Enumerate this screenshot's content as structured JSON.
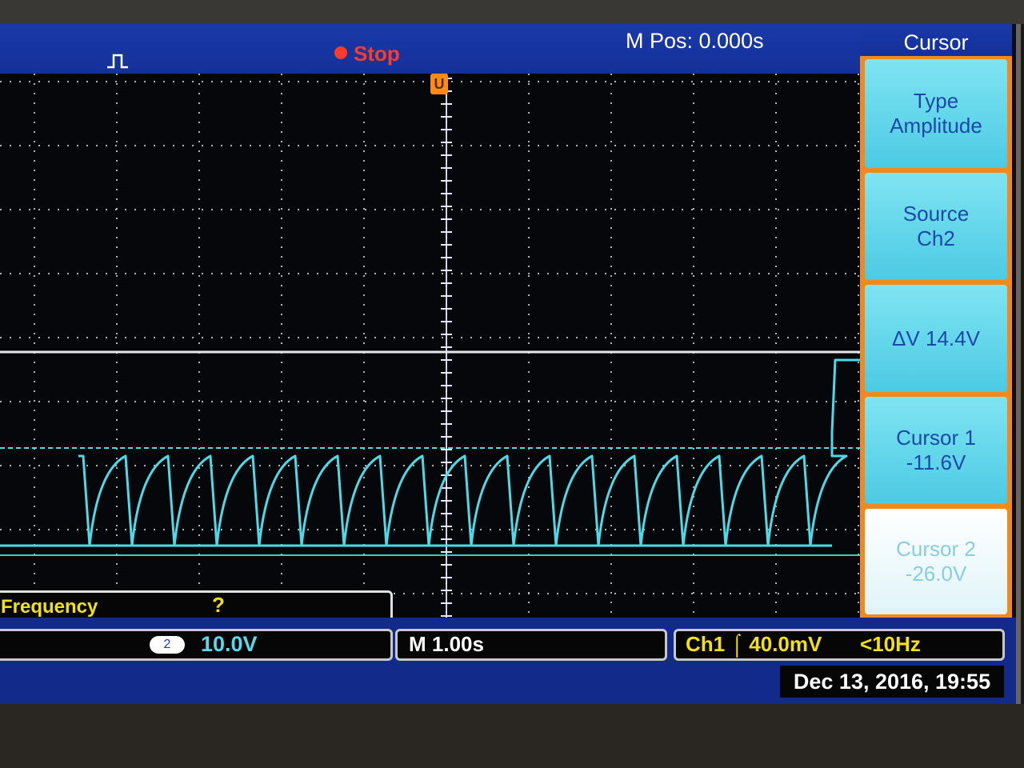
{
  "header": {
    "run_state": "Stop",
    "m_pos": "M Pos: 0.000s",
    "trigger_marker": "U"
  },
  "cursor_menu": {
    "title": "Cursor",
    "buttons": [
      {
        "line1": "Type",
        "line2": "Amplitude"
      },
      {
        "line1": "Source",
        "line2": "Ch2"
      },
      {
        "line1": "ΔV 14.4V",
        "line2": ""
      },
      {
        "line1": "Cursor 1",
        "line2": "-11.6V"
      },
      {
        "line1": "Cursor 2",
        "line2": "-26.0V"
      }
    ]
  },
  "measurement": {
    "label": "Frequency",
    "value": "?"
  },
  "status": {
    "ch2_badge": "2",
    "ch2_scale": "10.0V",
    "timebase": "M 1.00s",
    "ch1_trigger": "Ch1 ⌠ 40.0mV",
    "ch1_freq": "<10Hz",
    "datetime": "Dec 13, 2016, 19:55"
  },
  "colors": {
    "trace_ch2": "#4fd8e6",
    "grid": "#d0d0d0",
    "menu_button": "#5fd4ea",
    "header_blue": "#1a3aa8",
    "accent_orange": "#f08a1a",
    "status_yellow": "#f2e010"
  }
}
